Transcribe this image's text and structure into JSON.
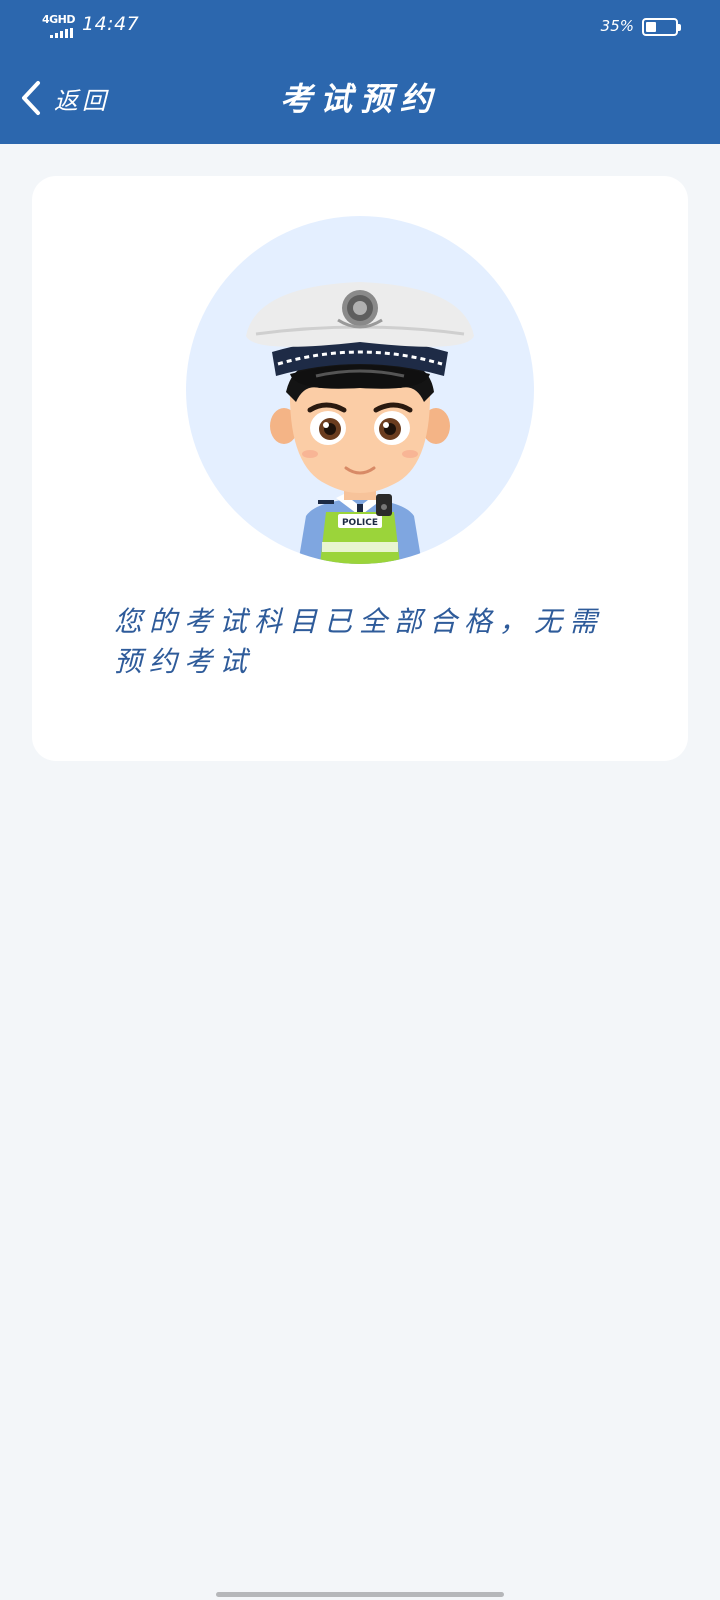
{
  "status_bar": {
    "network": "4GHD",
    "time": "14:47",
    "battery_percent_label": "35%",
    "battery_level": 0.35
  },
  "header": {
    "back_label": "返回",
    "title": "考试预约"
  },
  "card": {
    "avatar_icon": "police-officer-avatar",
    "avatar_badge_text": "POLICE",
    "message": "您的考试科目已全部合格，无需预约考试"
  },
  "colors": {
    "primary": "#2c67ae",
    "background": "#f3f6f9",
    "message_text": "#2e5b9a",
    "avatar_bg": "#e4efff"
  }
}
